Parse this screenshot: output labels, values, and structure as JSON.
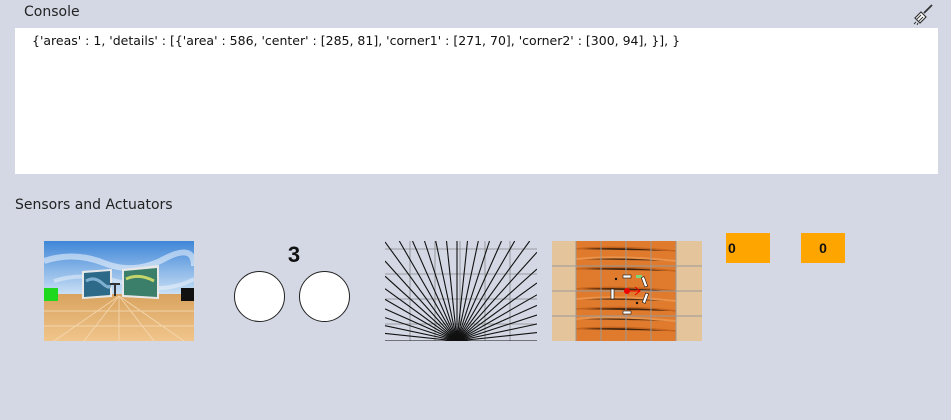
{
  "console": {
    "title": "Console",
    "clear_icon": "broom-icon",
    "output": "{'areas' : 1, 'details' : [{'area' : 586, 'center' : [285, 81], 'corner1' : [271, 70], 'corner2' : [300, 94], }], }"
  },
  "sensors": {
    "title": "Sensors and Actuators",
    "counter": "3",
    "led_left": "0",
    "led_right": "0"
  },
  "colors": {
    "background": "#d3d8e4",
    "led": "#ffa500",
    "console_bg": "#ffffff"
  }
}
